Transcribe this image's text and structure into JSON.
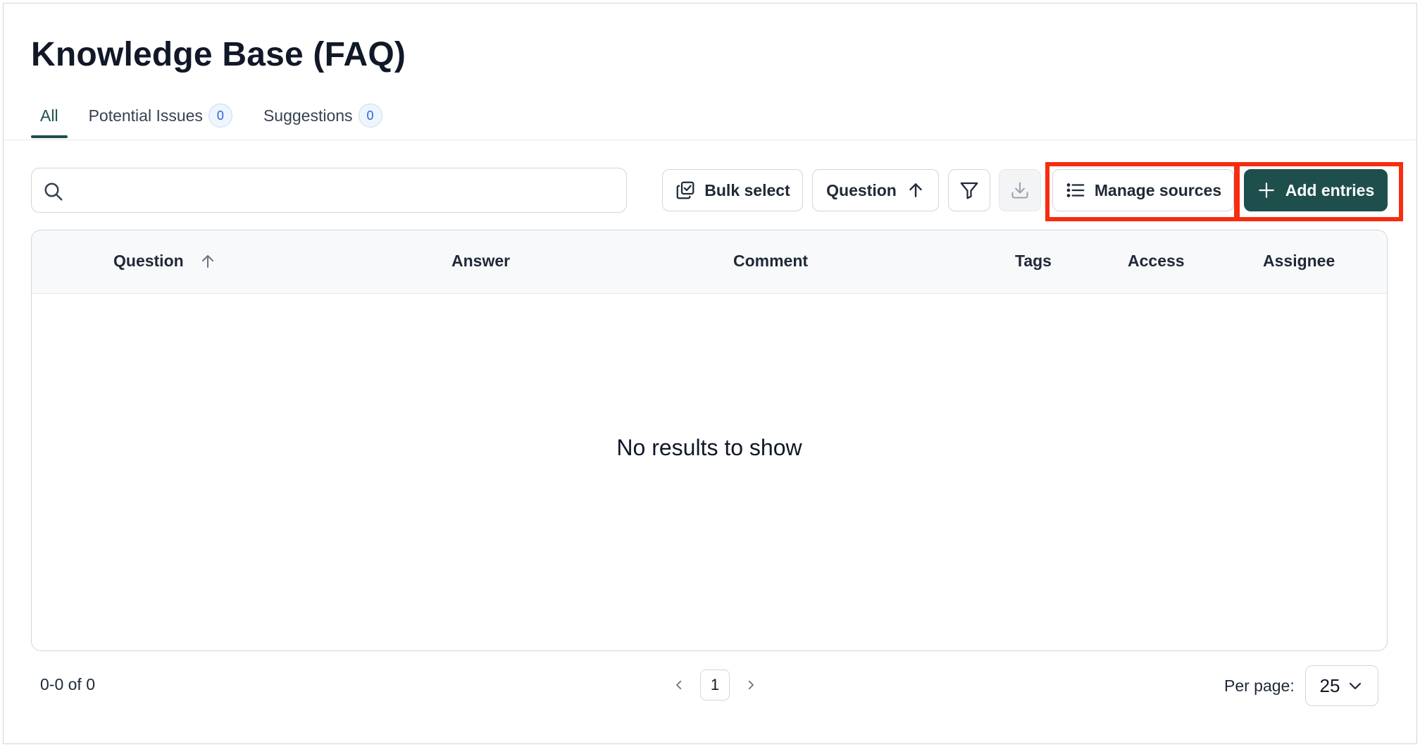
{
  "page": {
    "title": "Knowledge Base (FAQ)"
  },
  "tabs": [
    {
      "label": "All",
      "active": true
    },
    {
      "label": "Potential Issues",
      "count": "0"
    },
    {
      "label": "Suggestions",
      "count": "0"
    }
  ],
  "search": {
    "value": "",
    "placeholder": ""
  },
  "toolbar": {
    "bulk_select_label": "Bulk select",
    "sort_label": "Question",
    "manage_sources_label": "Manage sources",
    "add_entries_label": "Add entries"
  },
  "table": {
    "columns": [
      "Question",
      "Answer",
      "Comment",
      "Tags",
      "Access",
      "Assignee"
    ],
    "sorted_column": "Question",
    "sort_direction": "ascending",
    "empty_message": "No results to show"
  },
  "pagination": {
    "range_text": "0-0 of 0",
    "current_page": "1",
    "per_page_label": "Per page:",
    "per_page_value": "25"
  },
  "colors": {
    "accent": "#1f4f4d",
    "highlight": "#f62d0f",
    "badge_text": "#2563eb"
  },
  "icons": [
    "search-icon",
    "bulk-select-icon",
    "arrow-up-icon",
    "filter-icon",
    "download-icon",
    "list-icon",
    "plus-icon",
    "chevron-left-icon",
    "chevron-right-icon",
    "chevron-down-icon"
  ]
}
